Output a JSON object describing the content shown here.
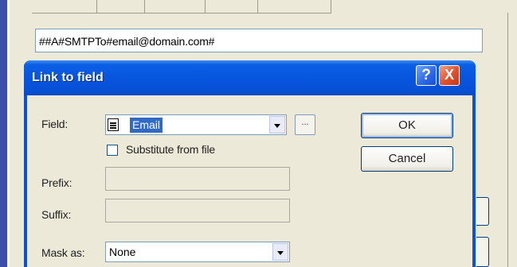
{
  "background": {
    "expression_value": "##A#SMTPTo#email@domain.com#"
  },
  "dialog": {
    "title": "Link to field",
    "help_glyph": "?",
    "close_glyph": "X",
    "field": {
      "label": "Field:",
      "selected": "Email",
      "icon": "field-table-icon",
      "browse_label": "..."
    },
    "substitute": {
      "label": "Substitute from file",
      "checked": false
    },
    "prefix": {
      "label": "Prefix:",
      "value": ""
    },
    "suffix": {
      "label": "Suffix:",
      "value": ""
    },
    "mask": {
      "label": "Mask as:",
      "selected": "None"
    },
    "ok_label": "OK",
    "cancel_label": "Cancel"
  },
  "colors": {
    "titlebar": "#0a5fe4",
    "face": "#ECE9D8",
    "selection": "#316ac5",
    "close_button": "#e0502c"
  }
}
